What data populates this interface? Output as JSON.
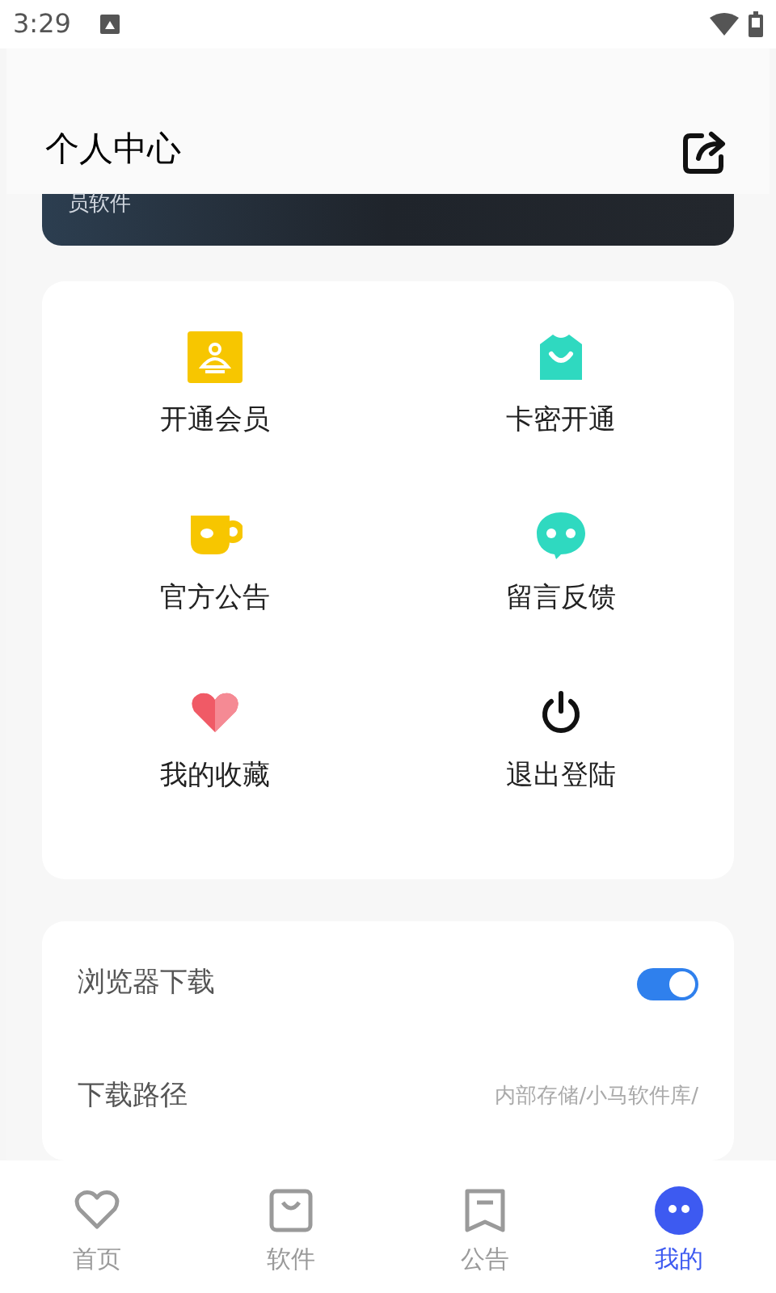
{
  "status_bar": {
    "time": "3:29"
  },
  "header": {
    "title": "个人中心"
  },
  "banner": {
    "text": "员软件"
  },
  "menu": [
    {
      "label": "开通会员",
      "kind": "vip"
    },
    {
      "label": "卡密开通",
      "kind": "bag"
    },
    {
      "label": "官方公告",
      "kind": "cup"
    },
    {
      "label": "留言反馈",
      "kind": "chat"
    },
    {
      "label": "我的收藏",
      "kind": "heart"
    },
    {
      "label": "退出登陆",
      "kind": "power"
    }
  ],
  "settings": [
    {
      "label": "浏览器下载",
      "kind": "toggle",
      "on": true
    },
    {
      "label": "下载路径",
      "kind": "value",
      "value": "内部存储/小马软件库/"
    }
  ],
  "tabs": [
    {
      "label": "首页",
      "kind": "home",
      "selected": false
    },
    {
      "label": "软件",
      "kind": "bag",
      "selected": false
    },
    {
      "label": "公告",
      "kind": "note",
      "selected": false
    },
    {
      "label": "我的",
      "kind": "me",
      "selected": true
    }
  ]
}
